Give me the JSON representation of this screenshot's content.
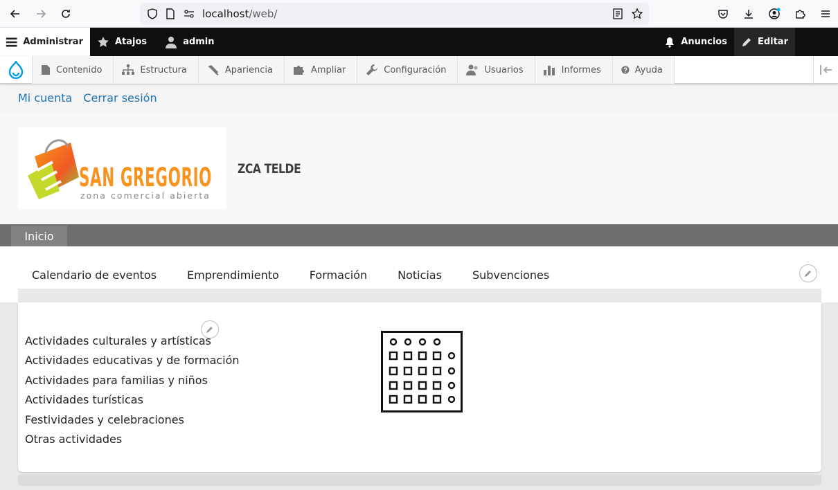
{
  "browser": {
    "url_host": "localhost",
    "url_path": "/web/"
  },
  "admin_toolbar": {
    "manage": "Administrar",
    "shortcuts": "Atajos",
    "user": "admin",
    "announcements": "Anuncios",
    "edit": "Editar"
  },
  "tray": {
    "items": [
      "Contenido",
      "Estructura",
      "Apariencia",
      "Ampliar",
      "Configuración",
      "Usuarios",
      "Informes",
      "Ayuda"
    ]
  },
  "account": {
    "my_account": "Mi cuenta",
    "logout": "Cerrar sesión"
  },
  "header": {
    "logo_title": "SAN GREGORIO",
    "logo_subtitle": "zona comercial abierta",
    "site_name": "ZCA TELDE"
  },
  "primary_nav": {
    "home": "Inicio"
  },
  "secondary_menu": {
    "items": [
      "Calendario de eventos",
      "Emprendimiento",
      "Formación",
      "Noticias",
      "Subvenciones"
    ]
  },
  "categories": {
    "items": [
      "Actividades culturales y artísticas",
      "Actividades educativas y de formación",
      "Actividades para familias y niños",
      "Actividades turísticas",
      "Festividades y celebraciones",
      "Otras actividades"
    ]
  },
  "colors": {
    "link": "#1f73b7",
    "admin_bar": "#0f0f0f",
    "primary_nav": "#6e6e6e"
  }
}
